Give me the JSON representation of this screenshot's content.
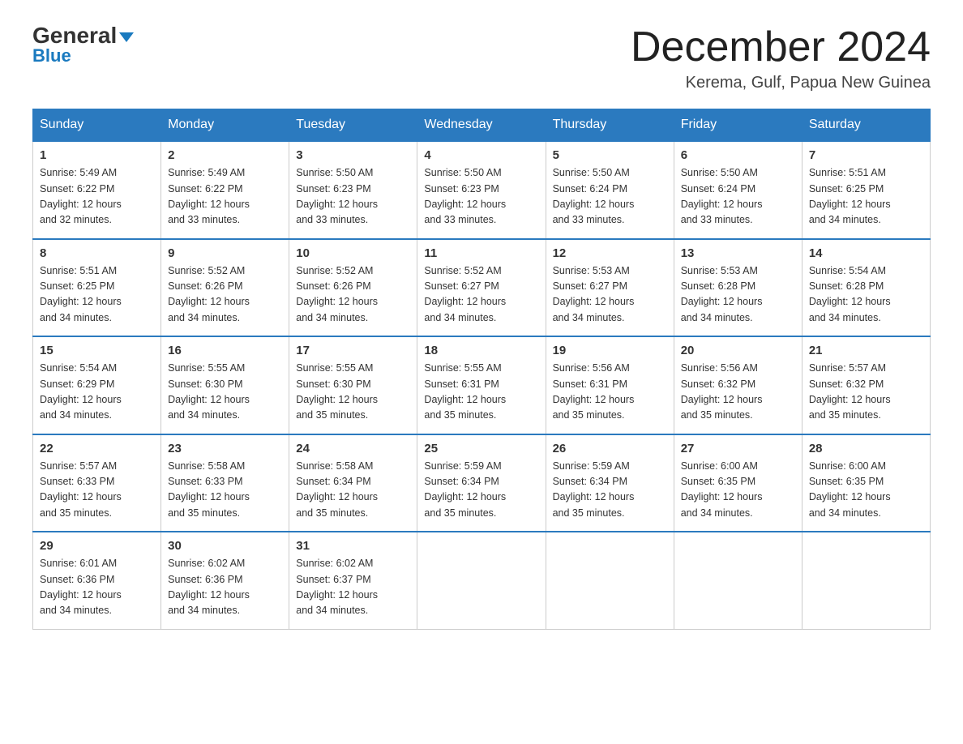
{
  "header": {
    "logo_line1": "General",
    "logo_line2": "Blue",
    "month_title": "December 2024",
    "location": "Kerema, Gulf, Papua New Guinea"
  },
  "days_of_week": [
    "Sunday",
    "Monday",
    "Tuesday",
    "Wednesday",
    "Thursday",
    "Friday",
    "Saturday"
  ],
  "weeks": [
    [
      {
        "day": "1",
        "sunrise": "5:49 AM",
        "sunset": "6:22 PM",
        "daylight": "12 hours and 32 minutes."
      },
      {
        "day": "2",
        "sunrise": "5:49 AM",
        "sunset": "6:22 PM",
        "daylight": "12 hours and 33 minutes."
      },
      {
        "day": "3",
        "sunrise": "5:50 AM",
        "sunset": "6:23 PM",
        "daylight": "12 hours and 33 minutes."
      },
      {
        "day": "4",
        "sunrise": "5:50 AM",
        "sunset": "6:23 PM",
        "daylight": "12 hours and 33 minutes."
      },
      {
        "day": "5",
        "sunrise": "5:50 AM",
        "sunset": "6:24 PM",
        "daylight": "12 hours and 33 minutes."
      },
      {
        "day": "6",
        "sunrise": "5:50 AM",
        "sunset": "6:24 PM",
        "daylight": "12 hours and 33 minutes."
      },
      {
        "day": "7",
        "sunrise": "5:51 AM",
        "sunset": "6:25 PM",
        "daylight": "12 hours and 34 minutes."
      }
    ],
    [
      {
        "day": "8",
        "sunrise": "5:51 AM",
        "sunset": "6:25 PM",
        "daylight": "12 hours and 34 minutes."
      },
      {
        "day": "9",
        "sunrise": "5:52 AM",
        "sunset": "6:26 PM",
        "daylight": "12 hours and 34 minutes."
      },
      {
        "day": "10",
        "sunrise": "5:52 AM",
        "sunset": "6:26 PM",
        "daylight": "12 hours and 34 minutes."
      },
      {
        "day": "11",
        "sunrise": "5:52 AM",
        "sunset": "6:27 PM",
        "daylight": "12 hours and 34 minutes."
      },
      {
        "day": "12",
        "sunrise": "5:53 AM",
        "sunset": "6:27 PM",
        "daylight": "12 hours and 34 minutes."
      },
      {
        "day": "13",
        "sunrise": "5:53 AM",
        "sunset": "6:28 PM",
        "daylight": "12 hours and 34 minutes."
      },
      {
        "day": "14",
        "sunrise": "5:54 AM",
        "sunset": "6:28 PM",
        "daylight": "12 hours and 34 minutes."
      }
    ],
    [
      {
        "day": "15",
        "sunrise": "5:54 AM",
        "sunset": "6:29 PM",
        "daylight": "12 hours and 34 minutes."
      },
      {
        "day": "16",
        "sunrise": "5:55 AM",
        "sunset": "6:30 PM",
        "daylight": "12 hours and 34 minutes."
      },
      {
        "day": "17",
        "sunrise": "5:55 AM",
        "sunset": "6:30 PM",
        "daylight": "12 hours and 35 minutes."
      },
      {
        "day": "18",
        "sunrise": "5:55 AM",
        "sunset": "6:31 PM",
        "daylight": "12 hours and 35 minutes."
      },
      {
        "day": "19",
        "sunrise": "5:56 AM",
        "sunset": "6:31 PM",
        "daylight": "12 hours and 35 minutes."
      },
      {
        "day": "20",
        "sunrise": "5:56 AM",
        "sunset": "6:32 PM",
        "daylight": "12 hours and 35 minutes."
      },
      {
        "day": "21",
        "sunrise": "5:57 AM",
        "sunset": "6:32 PM",
        "daylight": "12 hours and 35 minutes."
      }
    ],
    [
      {
        "day": "22",
        "sunrise": "5:57 AM",
        "sunset": "6:33 PM",
        "daylight": "12 hours and 35 minutes."
      },
      {
        "day": "23",
        "sunrise": "5:58 AM",
        "sunset": "6:33 PM",
        "daylight": "12 hours and 35 minutes."
      },
      {
        "day": "24",
        "sunrise": "5:58 AM",
        "sunset": "6:34 PM",
        "daylight": "12 hours and 35 minutes."
      },
      {
        "day": "25",
        "sunrise": "5:59 AM",
        "sunset": "6:34 PM",
        "daylight": "12 hours and 35 minutes."
      },
      {
        "day": "26",
        "sunrise": "5:59 AM",
        "sunset": "6:34 PM",
        "daylight": "12 hours and 35 minutes."
      },
      {
        "day": "27",
        "sunrise": "6:00 AM",
        "sunset": "6:35 PM",
        "daylight": "12 hours and 34 minutes."
      },
      {
        "day": "28",
        "sunrise": "6:00 AM",
        "sunset": "6:35 PM",
        "daylight": "12 hours and 34 minutes."
      }
    ],
    [
      {
        "day": "29",
        "sunrise": "6:01 AM",
        "sunset": "6:36 PM",
        "daylight": "12 hours and 34 minutes."
      },
      {
        "day": "30",
        "sunrise": "6:02 AM",
        "sunset": "6:36 PM",
        "daylight": "12 hours and 34 minutes."
      },
      {
        "day": "31",
        "sunrise": "6:02 AM",
        "sunset": "6:37 PM",
        "daylight": "12 hours and 34 minutes."
      },
      null,
      null,
      null,
      null
    ]
  ],
  "labels": {
    "sunrise": "Sunrise:",
    "sunset": "Sunset:",
    "daylight": "Daylight:"
  }
}
